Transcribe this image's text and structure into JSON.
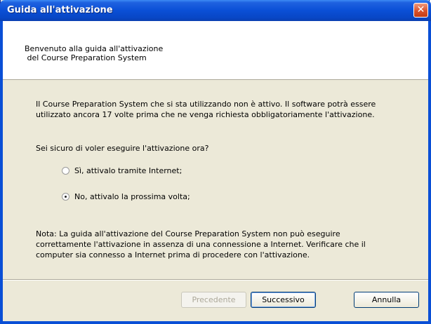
{
  "window": {
    "title": "Guida all'attivazione",
    "close_glyph": "✕"
  },
  "header": {
    "text": "Benvenuto alla guida all'attivazione\n del Course Preparation System"
  },
  "content": {
    "paragraph1": "Il Course Preparation System che si sta utilizzando non è attivo. Il software potrà essere\nutilizzato ancora 17 volte prima che ne venga richiesta obbligatoriamente l'attivazione.",
    "question": "Sei sicuro di voler eseguire l'attivazione ora?",
    "options": [
      {
        "label": "Sì, attivalo tramite Internet;",
        "checked": false
      },
      {
        "label": "No, attivalo la prossima volta;",
        "checked": true
      }
    ],
    "note": "Nota: La guida all'attivazione del Course Preparation System non può eseguire\ncorrettamente l'attivazione in assenza di una connessione a Internet. Verificare che il\ncomputer sia connesso a Internet prima di procedere con l'attivazione."
  },
  "buttons": {
    "back": "Precedente",
    "next": "Successivo",
    "cancel": "Annulla"
  }
}
